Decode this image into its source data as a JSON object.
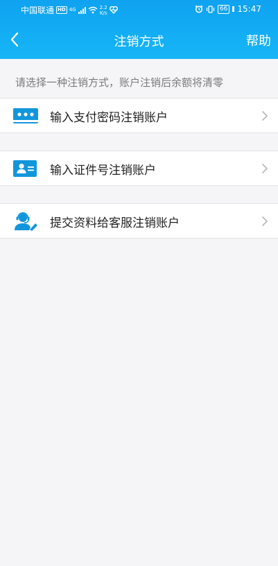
{
  "status_bar": {
    "carrier": "中国联通",
    "hd": "HD",
    "network": "4G",
    "speed_value": "2.2",
    "speed_unit": "K/s",
    "battery": "66",
    "time": "15:47"
  },
  "nav": {
    "title": "注销方式",
    "help_label": "帮助"
  },
  "hint": "请选择一种注销方式，账户注销后余额将清零",
  "options": [
    {
      "label": "输入支付密码注销账户",
      "icon": "password-card-icon"
    },
    {
      "label": "输入证件号注销账户",
      "icon": "id-card-icon"
    },
    {
      "label": "提交资料给客服注销账户",
      "icon": "customer-service-icon"
    }
  ],
  "colors": {
    "header_blue": "#16b6f7",
    "icon_blue": "#1296db",
    "background": "#f5f5f7"
  }
}
